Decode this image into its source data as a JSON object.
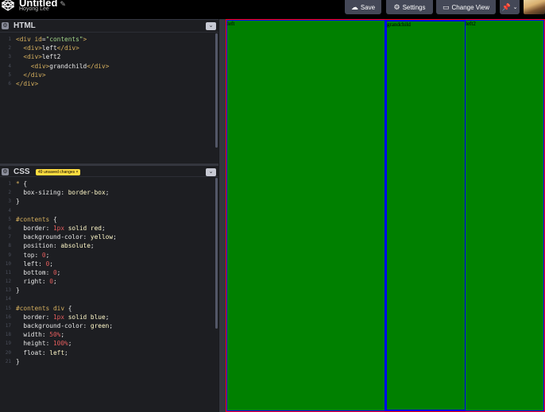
{
  "app": {
    "title": "Untitled",
    "author": "Hoyong Lee"
  },
  "header": {
    "save_label": "Save",
    "settings_label": "Settings",
    "change_view_label": "Change View"
  },
  "html_pane": {
    "title": "HTML",
    "lines": [
      {
        "n": "1",
        "parts": [
          [
            "c-tag",
            "<div "
          ],
          [
            "c-attr",
            "id"
          ],
          [
            "c-punc",
            "="
          ],
          [
            "c-str",
            "\"contents\""
          ],
          [
            "c-tag",
            ">"
          ]
        ]
      },
      {
        "n": "2",
        "parts": [
          [
            "c-plain",
            "  "
          ],
          [
            "c-tag",
            "<div>"
          ],
          [
            "c-plain",
            "left"
          ],
          [
            "c-tag",
            "</div>"
          ]
        ]
      },
      {
        "n": "3",
        "parts": [
          [
            "c-plain",
            "  "
          ],
          [
            "c-tag",
            "<div>"
          ],
          [
            "c-plain",
            "left2"
          ]
        ]
      },
      {
        "n": "4",
        "parts": [
          [
            "c-plain",
            "    "
          ],
          [
            "c-tag",
            "<div>"
          ],
          [
            "c-plain",
            "grandchild"
          ],
          [
            "c-tag",
            "</div>"
          ]
        ]
      },
      {
        "n": "5",
        "parts": [
          [
            "c-plain",
            "  "
          ],
          [
            "c-tag",
            "</div>"
          ]
        ]
      },
      {
        "n": "6",
        "parts": [
          [
            "c-tag",
            "</div>"
          ]
        ]
      }
    ]
  },
  "css_pane": {
    "title": "CSS",
    "unsaved_badge": "49 unsaved changes ×",
    "lines": [
      {
        "n": "1",
        "parts": [
          [
            "c-sel",
            "* "
          ],
          [
            "c-punc",
            "{"
          ]
        ]
      },
      {
        "n": "2",
        "parts": [
          [
            "c-plain",
            "  "
          ],
          [
            "c-prop",
            "box-sizing"
          ],
          [
            "c-punc",
            ": "
          ],
          [
            "c-val",
            "border-box"
          ],
          [
            "c-punc",
            ";"
          ]
        ]
      },
      {
        "n": "3",
        "parts": [
          [
            "c-punc",
            "}"
          ]
        ]
      },
      {
        "n": "4",
        "parts": []
      },
      {
        "n": "5",
        "parts": [
          [
            "c-sel",
            "#contents "
          ],
          [
            "c-punc",
            "{"
          ]
        ]
      },
      {
        "n": "6",
        "parts": [
          [
            "c-plain",
            "  "
          ],
          [
            "c-prop",
            "border"
          ],
          [
            "c-punc",
            ": "
          ],
          [
            "c-num",
            "1px"
          ],
          [
            "c-val",
            " solid red"
          ],
          [
            "c-punc",
            ";"
          ]
        ]
      },
      {
        "n": "7",
        "parts": [
          [
            "c-plain",
            "  "
          ],
          [
            "c-prop",
            "background-color"
          ],
          [
            "c-punc",
            ": "
          ],
          [
            "c-val",
            "yellow"
          ],
          [
            "c-punc",
            ";"
          ]
        ]
      },
      {
        "n": "8",
        "parts": [
          [
            "c-plain",
            "  "
          ],
          [
            "c-prop",
            "position"
          ],
          [
            "c-punc",
            ": "
          ],
          [
            "c-val",
            "absolute"
          ],
          [
            "c-punc",
            ";"
          ]
        ]
      },
      {
        "n": "9",
        "parts": [
          [
            "c-plain",
            "  "
          ],
          [
            "c-prop",
            "top"
          ],
          [
            "c-punc",
            ": "
          ],
          [
            "c-num",
            "0"
          ],
          [
            "c-punc",
            ";"
          ]
        ]
      },
      {
        "n": "10",
        "parts": [
          [
            "c-plain",
            "  "
          ],
          [
            "c-prop",
            "left"
          ],
          [
            "c-punc",
            ": "
          ],
          [
            "c-num",
            "0"
          ],
          [
            "c-punc",
            ";"
          ]
        ]
      },
      {
        "n": "11",
        "parts": [
          [
            "c-plain",
            "  "
          ],
          [
            "c-prop",
            "bottom"
          ],
          [
            "c-punc",
            ": "
          ],
          [
            "c-num",
            "0"
          ],
          [
            "c-punc",
            ";"
          ]
        ]
      },
      {
        "n": "12",
        "parts": [
          [
            "c-plain",
            "  "
          ],
          [
            "c-prop",
            "right"
          ],
          [
            "c-punc",
            ": "
          ],
          [
            "c-num",
            "0"
          ],
          [
            "c-punc",
            ";"
          ]
        ]
      },
      {
        "n": "13",
        "parts": [
          [
            "c-punc",
            "}"
          ]
        ]
      },
      {
        "n": "14",
        "parts": []
      },
      {
        "n": "15",
        "parts": [
          [
            "c-sel",
            "#contents div "
          ],
          [
            "c-punc",
            "{"
          ]
        ]
      },
      {
        "n": "16",
        "parts": [
          [
            "c-plain",
            "  "
          ],
          [
            "c-prop",
            "border"
          ],
          [
            "c-punc",
            ": "
          ],
          [
            "c-num",
            "1px"
          ],
          [
            "c-val",
            " solid blue"
          ],
          [
            "c-punc",
            ";"
          ]
        ]
      },
      {
        "n": "17",
        "parts": [
          [
            "c-plain",
            "  "
          ],
          [
            "c-prop",
            "background-color"
          ],
          [
            "c-punc",
            ": "
          ],
          [
            "c-val",
            "green"
          ],
          [
            "c-punc",
            ";"
          ]
        ]
      },
      {
        "n": "18",
        "parts": [
          [
            "c-plain",
            "  "
          ],
          [
            "c-prop",
            "width"
          ],
          [
            "c-punc",
            ": "
          ],
          [
            "c-num",
            "50%"
          ],
          [
            "c-punc",
            ";"
          ]
        ]
      },
      {
        "n": "19",
        "parts": [
          [
            "c-plain",
            "  "
          ],
          [
            "c-prop",
            "height"
          ],
          [
            "c-punc",
            ": "
          ],
          [
            "c-num",
            "100%"
          ],
          [
            "c-punc",
            ";"
          ]
        ]
      },
      {
        "n": "20",
        "parts": [
          [
            "c-plain",
            "  "
          ],
          [
            "c-prop",
            "float"
          ],
          [
            "c-punc",
            ": "
          ],
          [
            "c-val",
            "left"
          ],
          [
            "c-punc",
            ";"
          ]
        ]
      },
      {
        "n": "21",
        "parts": [
          [
            "c-punc",
            "}"
          ]
        ]
      }
    ]
  },
  "preview": {
    "left_label": "left",
    "grandchild_label": "grandchild",
    "left2_label": "left2"
  },
  "colors": {
    "accent_badge": "#ffdd40",
    "preview_bg": "#ffff00",
    "box_bg": "#008000"
  }
}
